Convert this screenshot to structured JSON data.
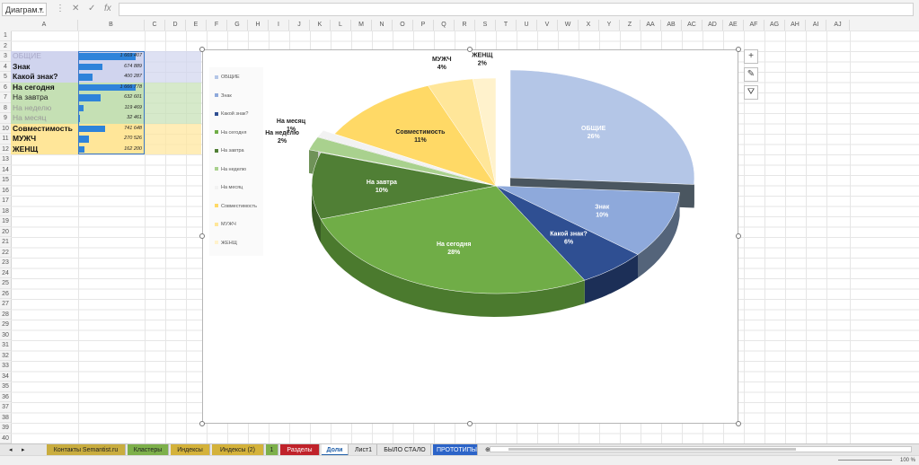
{
  "namebox": "Диаграм...",
  "columns": [
    "A",
    "B",
    "C",
    "D",
    "E",
    "F",
    "G",
    "H",
    "I",
    "J",
    "K",
    "L",
    "M",
    "N",
    "O",
    "P",
    "Q",
    "R",
    "S",
    "T",
    "U",
    "V",
    "W",
    "X",
    "Y",
    "Z",
    "AA",
    "AB",
    "AC",
    "AD",
    "AE",
    "AF",
    "AG",
    "AH",
    "AI",
    "AJ"
  ],
  "rows": [
    "1",
    "2",
    "3",
    "4",
    "5",
    "6",
    "7",
    "8",
    "9",
    "10",
    "11",
    "12",
    "13",
    "14",
    "15",
    "16",
    "17",
    "18",
    "19",
    "20",
    "21",
    "22",
    "23",
    "24",
    "25",
    "26",
    "27",
    "28",
    "29",
    "30",
    "31",
    "32",
    "33",
    "34",
    "35",
    "36",
    "37",
    "38",
    "39",
    "40"
  ],
  "table": [
    {
      "label": "ОБЩИЕ",
      "value": "1 669 407",
      "frac": 0.88,
      "bg": "#d0d4ee",
      "fg": "#a8a8c8",
      "bold": false
    },
    {
      "label": "Знак",
      "value": "674 889",
      "frac": 0.36,
      "bg": "#d0d4ee",
      "fg": "#111111",
      "bold": true
    },
    {
      "label": "Какой знак?",
      "value": "400 287",
      "frac": 0.21,
      "bg": "#d0d4ee",
      "fg": "#111111",
      "bold": true
    },
    {
      "label": "На сегодня",
      "value": "1 666 778",
      "frac": 0.88,
      "bg": "#c5e0b4",
      "fg": "#111111",
      "bold": true
    },
    {
      "label": "На завтра",
      "value": "632 601",
      "frac": 0.34,
      "bg": "#c5e0b4",
      "fg": "#222222",
      "bold": false
    },
    {
      "label": "На неделю",
      "value": "119 469",
      "frac": 0.07,
      "bg": "#c5e0b4",
      "fg": "#999999",
      "bold": false
    },
    {
      "label": "На месяц",
      "value": "32 461",
      "frac": 0.02,
      "bg": "#c5e0b4",
      "fg": "#999999",
      "bold": false
    },
    {
      "label": "Совместимость",
      "value": "741 648",
      "frac": 0.4,
      "bg": "#ffe699",
      "fg": "#111111",
      "bold": true
    },
    {
      "label": "МУЖЧ",
      "value": "270 526",
      "frac": 0.15,
      "bg": "#ffe699",
      "fg": "#111111",
      "bold": true
    },
    {
      "label": "ЖЕНЩ",
      "value": "162 200",
      "frac": 0.09,
      "bg": "#ffe699",
      "fg": "#111111",
      "bold": true
    }
  ],
  "chart_data": {
    "type": "pie",
    "title": "",
    "legend_position": "left",
    "slices": [
      {
        "name": "ОБЩИЕ",
        "label": "ОБЩИЕ",
        "pct_label": "26%",
        "value": 26,
        "color": "#b4c6e7",
        "side": "#4a5660",
        "exploded": true
      },
      {
        "name": "Знак",
        "label": "Знак",
        "pct_label": "10%",
        "value": 10,
        "color": "#8ea9db",
        "side": "#54647a",
        "exploded": false
      },
      {
        "name": "Какой знак?",
        "label": "Какой знак?",
        "pct_label": "6%",
        "value": 6,
        "color": "#2f4f92",
        "side": "#1c2f57",
        "exploded": false
      },
      {
        "name": "На сегодня",
        "label": "На сегодня",
        "pct_label": "28%",
        "value": 28,
        "color": "#70ad47",
        "side": "#4b7a2e",
        "exploded": false
      },
      {
        "name": "На завтра",
        "label": "На завтра",
        "pct_label": "10%",
        "value": 10,
        "color": "#507f35",
        "side": "#385b25",
        "exploded": false
      },
      {
        "name": "На неделю",
        "label": "На неделю",
        "pct_label": "2%",
        "value": 2,
        "color": "#a9d18e",
        "side": "#6f9258",
        "exploded": true
      },
      {
        "name": "На месяц",
        "label": "На месяц",
        "pct_label": "1%",
        "value": 1,
        "color": "#f2f2f2",
        "side": "#c9c9c9",
        "exploded": true
      },
      {
        "name": "Совместимость",
        "label": "Совместимость",
        "pct_label": "11%",
        "value": 11,
        "color": "#ffd966",
        "side": "#bfa040",
        "exploded": false
      },
      {
        "name": "МУЖЧ",
        "label": "МУЖЧ",
        "pct_label": "4%",
        "value": 4,
        "color": "#ffe699",
        "side": "#c6b06a",
        "exploded": false
      },
      {
        "name": "ЖЕНЩ",
        "label": "ЖЕНЩ",
        "pct_label": "2%",
        "value": 2,
        "color": "#fff2cc",
        "side": "#cdbf98",
        "exploded": false
      }
    ]
  },
  "chart_tools": [
    "+",
    "✎",
    "⛛"
  ],
  "tabs": [
    {
      "label": "Контакты Semantist.ru",
      "bg": "#c9ad3f",
      "fg": "#222222"
    },
    {
      "label": "Кластеры",
      "bg": "#7db04a",
      "fg": "#222222"
    },
    {
      "label": "Индексы",
      "bg": "#d4b23a",
      "fg": "#222222"
    },
    {
      "label": "Индексы (2)",
      "bg": "#d4b23a",
      "fg": "#222222"
    },
    {
      "label": "1",
      "bg": "#7db04a",
      "fg": "#222222"
    },
    {
      "label": "Разделы",
      "bg": "#c0222a",
      "fg": "#ffffff"
    },
    {
      "label": "Доли",
      "bg": "#ffffff",
      "fg": "#1e5ea8"
    },
    {
      "label": "Лист1",
      "bg": "#e6e6e6",
      "fg": "#222222"
    },
    {
      "label": "БЫЛО СТАЛО",
      "bg": "#e6e6e6",
      "fg": "#222222"
    },
    {
      "label": "ПРОТОТИПЫ",
      "bg": "#2c64c8",
      "fg": "#ffffff"
    }
  ],
  "zoom": "100 %"
}
